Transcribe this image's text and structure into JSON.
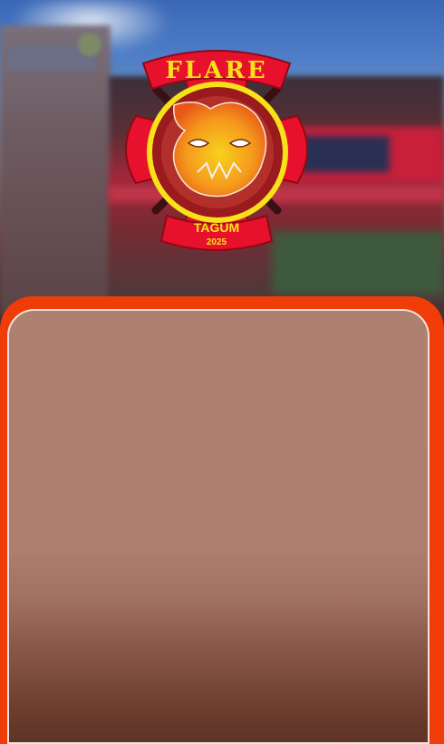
{
  "logo": {
    "title": "FLARE",
    "city": "TAGUM",
    "year": "2025"
  },
  "colors": {
    "sheet": "#f03c06",
    "card": "#ad8070",
    "logo_red": "#e8112d",
    "logo_yellow": "#f7e21a"
  },
  "icons": {
    "emblem": "fire-cross-emblem-icon",
    "mascot": "fire-mascot-icon"
  }
}
